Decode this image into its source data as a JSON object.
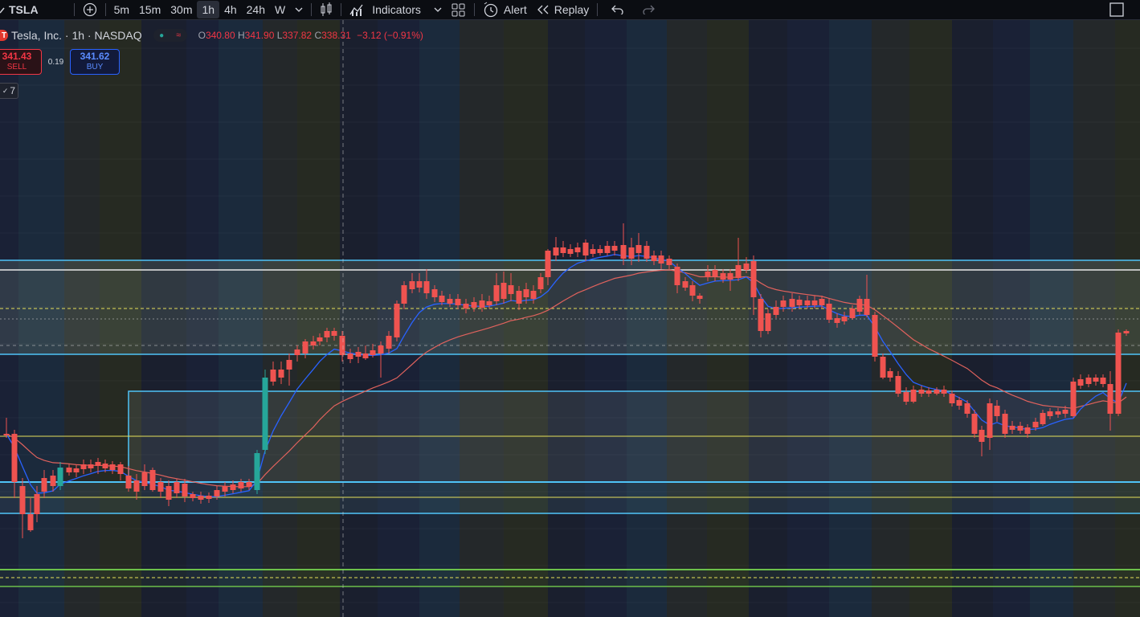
{
  "toolbar": {
    "symbol": "TSLA",
    "intervals": [
      "5m",
      "15m",
      "30m",
      "1h",
      "4h",
      "24h",
      "W"
    ],
    "active_interval": "1h",
    "indicators_label": "Indicators",
    "alert_label": "Alert",
    "replay_label": "Replay"
  },
  "legend": {
    "logo_letter": "T",
    "title": "Tesla, Inc. · 1h · NASDAQ",
    "open_label": "O",
    "open": "340.80",
    "high_label": "H",
    "high": "341.90",
    "low_label": "L",
    "low": "337.82",
    "close_label": "C",
    "close": "338.31",
    "change": "−3.12 (−0.91%)"
  },
  "trade": {
    "sell_price": "341.43",
    "sell_label": "SELL",
    "spread": "0.19",
    "buy_price": "341.62",
    "buy_label": "BUY"
  },
  "indicator_badge": "7",
  "colors": {
    "background": "#131722",
    "up": "#26a69a",
    "down": "#ef5350",
    "ma_fast": "#2962ff",
    "ma_slow": "#e0625d",
    "zone_line": "#4fc3f7",
    "yellow_line": "#e6e05a",
    "green_line": "#6cc04a"
  },
  "icons": [
    "search-icon",
    "add-symbol-icon",
    "chevron-down-icon",
    "bar-style-icon",
    "indicators-icon",
    "layout-icon",
    "alert-icon",
    "replay-icon",
    "undo-icon",
    "redo-icon",
    "fullscreen-icon"
  ]
}
